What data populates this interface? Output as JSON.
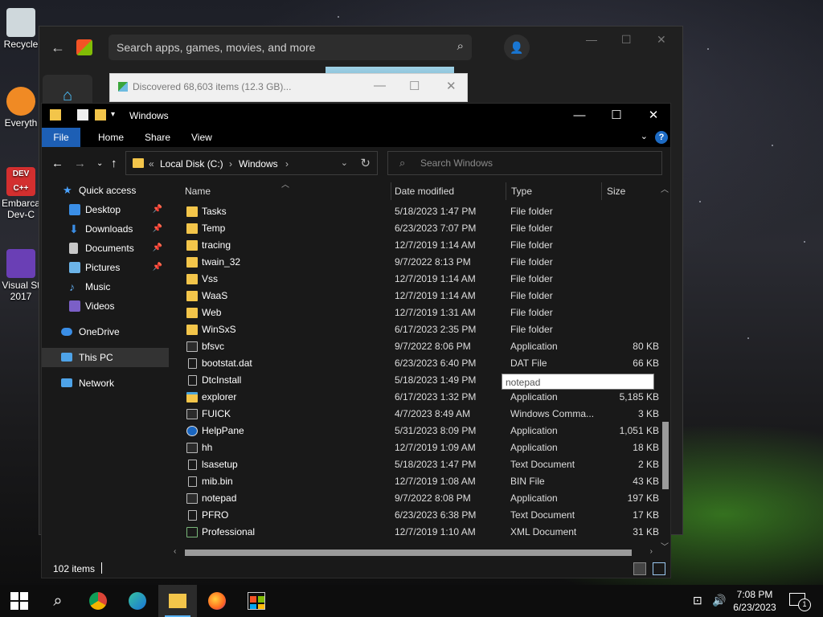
{
  "desktop": {
    "icons": [
      {
        "label": "Recycle",
        "color": "#cfd8dc"
      },
      {
        "label": "Everyth",
        "color": "#f08a24"
      },
      {
        "label": "Embarca",
        "label2": "Dev-C",
        "color": "#d32f2f",
        "badge": "DEV C++"
      },
      {
        "label": "Visual St",
        "label2": "2017",
        "color": "#6a3fb5"
      }
    ]
  },
  "store": {
    "search_placeholder": "Search apps, games, movies, and more"
  },
  "progress_dialog": {
    "text": "Discovered 68,603 items (12.3 GB)..."
  },
  "explorer": {
    "title": "Windows",
    "ribbon_tabs": [
      "File",
      "Home",
      "Share",
      "View"
    ],
    "address": {
      "prefix": "«",
      "seg1": "Local Disk (C:)",
      "sep": "›",
      "seg2": "Windows",
      "sep2": "›"
    },
    "search_placeholder": "Search Windows",
    "nav": {
      "quick_access": "Quick access",
      "desktop": "Desktop",
      "downloads": "Downloads",
      "documents": "Documents",
      "pictures": "Pictures",
      "music": "Music",
      "videos": "Videos",
      "onedrive": "OneDrive",
      "this_pc": "This PC",
      "network": "Network"
    },
    "columns": {
      "name": "Name",
      "date": "Date modified",
      "type": "Type",
      "size": "Size"
    },
    "rows": [
      {
        "name": "Tasks",
        "date": "5/18/2023 1:47 PM",
        "type": "File folder",
        "size": "",
        "icon": "folder"
      },
      {
        "name": "Temp",
        "date": "6/23/2023 7:07 PM",
        "type": "File folder",
        "size": "",
        "icon": "folder"
      },
      {
        "name": "tracing",
        "date": "12/7/2019 1:14 AM",
        "type": "File folder",
        "size": "",
        "icon": "folder"
      },
      {
        "name": "twain_32",
        "date": "9/7/2022 8:13 PM",
        "type": "File folder",
        "size": "",
        "icon": "folder"
      },
      {
        "name": "Vss",
        "date": "12/7/2019 1:14 AM",
        "type": "File folder",
        "size": "",
        "icon": "folder"
      },
      {
        "name": "WaaS",
        "date": "12/7/2019 1:14 AM",
        "type": "File folder",
        "size": "",
        "icon": "folder"
      },
      {
        "name": "Web",
        "date": "12/7/2019 1:31 AM",
        "type": "File folder",
        "size": "",
        "icon": "folder"
      },
      {
        "name": "WinSxS",
        "date": "6/17/2023 2:35 PM",
        "type": "File folder",
        "size": "",
        "icon": "folder"
      },
      {
        "name": "bfsvc",
        "date": "9/7/2022 8:06 PM",
        "type": "Application",
        "size": "80 KB",
        "icon": "app"
      },
      {
        "name": "bootstat.dat",
        "date": "6/23/2023 6:40 PM",
        "type": "DAT File",
        "size": "66 KB",
        "icon": "file"
      },
      {
        "name": "DtcInstall",
        "date": "5/18/2023 1:49 PM",
        "type": "",
        "size": "",
        "icon": "file"
      },
      {
        "name": "explorer",
        "date": "6/17/2023 1:32 PM",
        "type": "Application",
        "size": "5,185 KB",
        "icon": "exp"
      },
      {
        "name": "FUICK",
        "date": "4/7/2023 8:49 AM",
        "type": "Windows Comma...",
        "size": "3 KB",
        "icon": "app"
      },
      {
        "name": "HelpPane",
        "date": "5/31/2023 8:09 PM",
        "type": "Application",
        "size": "1,051 KB",
        "icon": "help"
      },
      {
        "name": "hh",
        "date": "12/7/2019 1:09 AM",
        "type": "Application",
        "size": "18 KB",
        "icon": "app"
      },
      {
        "name": "lsasetup",
        "date": "5/18/2023 1:47 PM",
        "type": "Text Document",
        "size": "2 KB",
        "icon": "file"
      },
      {
        "name": "mib.bin",
        "date": "12/7/2019 1:08 AM",
        "type": "BIN File",
        "size": "43 KB",
        "icon": "file"
      },
      {
        "name": "notepad",
        "date": "9/7/2022 8:08 PM",
        "type": "Application",
        "size": "197 KB",
        "icon": "app"
      },
      {
        "name": "PFRO",
        "date": "6/23/2023 6:38 PM",
        "type": "Text Document",
        "size": "17 KB",
        "icon": "file"
      },
      {
        "name": "Professional",
        "date": "12/7/2019 1:10 AM",
        "type": "XML Document",
        "size": "31 KB",
        "icon": "xml"
      }
    ],
    "tooltip": "notepad",
    "status": "102 items"
  },
  "taskbar": {
    "time": "7:08 PM",
    "date": "6/23/2023",
    "notification_count": "1"
  },
  "colors": {
    "accent": "#1d5fb5",
    "folder": "#f3c54a",
    "taskbar_active": "#5ab5ff"
  }
}
